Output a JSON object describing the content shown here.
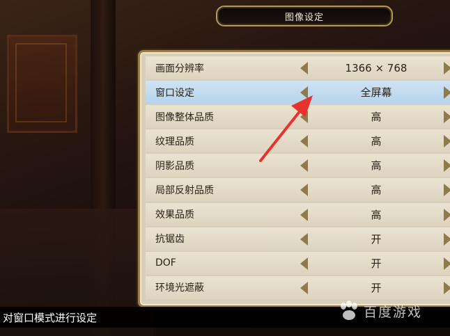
{
  "title": "图像设定",
  "settings": [
    {
      "label": "画面分辨率",
      "value": "1366 × 768"
    },
    {
      "label": "窗口设定",
      "value": "全屏幕"
    },
    {
      "label": "图像整体品质",
      "value": "高"
    },
    {
      "label": "纹理品质",
      "value": "高"
    },
    {
      "label": "阴影品质",
      "value": "高"
    },
    {
      "label": "局部反射品质",
      "value": "高"
    },
    {
      "label": "效果品质",
      "value": "高"
    },
    {
      "label": "抗锯齿",
      "value": "开"
    },
    {
      "label": "DOF",
      "value": "开"
    },
    {
      "label": "环境光遮蔽",
      "value": "开"
    }
  ],
  "selected_index": 1,
  "hint": "对窗口模式进行设定",
  "watermark": "百度游戏",
  "colors": {
    "accent_selected": "#b6d4ec",
    "annotation": "#e8322e",
    "panel": "#d8ceba",
    "frame_gold": "#b59a5a"
  }
}
